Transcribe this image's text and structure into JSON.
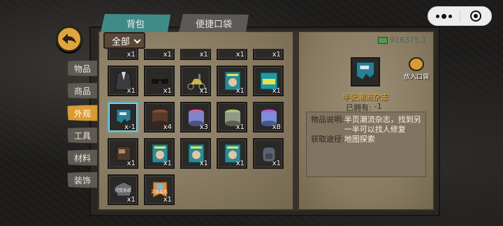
{
  "tabs": [
    {
      "label": "背包",
      "active": true
    },
    {
      "label": "便捷口袋",
      "active": false
    }
  ],
  "filter": {
    "selected": "全部"
  },
  "categories": [
    {
      "label": "物品",
      "active": false
    },
    {
      "label": "商品",
      "active": false
    },
    {
      "label": "外观",
      "active": true
    },
    {
      "label": "工具",
      "active": false
    },
    {
      "label": "材料",
      "active": false
    },
    {
      "label": "装饰",
      "active": false
    }
  ],
  "partial_row": [
    {
      "qty": "x1"
    },
    {
      "qty": "x1"
    },
    {
      "qty": "x1"
    },
    {
      "qty": "x1"
    },
    {
      "qty": "x1"
    }
  ],
  "items": [
    {
      "name": "suit-jacket",
      "qty": "x1",
      "selected": false,
      "label": ""
    },
    {
      "name": "sunglasses",
      "qty": "x1",
      "selected": false,
      "label": ""
    },
    {
      "name": "scooter",
      "qty": "x1",
      "selected": false,
      "label": ""
    },
    {
      "name": "magazine",
      "qty": "x1",
      "selected": false,
      "label": ""
    },
    {
      "name": "sticker-pack",
      "qty": "x1",
      "selected": false,
      "label": ""
    },
    {
      "name": "half-trend-magazine",
      "qty": "x-1",
      "selected": true,
      "label": ""
    },
    {
      "name": "brown-paint-can",
      "qty": "x4",
      "selected": false,
      "label": ""
    },
    {
      "name": "pink-paint-can",
      "qty": "x3",
      "selected": false,
      "label": ""
    },
    {
      "name": "green-paint-can",
      "qty": "x1",
      "selected": false,
      "label": ""
    },
    {
      "name": "purple-paint-can",
      "qty": "x8",
      "selected": false,
      "label": ""
    },
    {
      "name": "leather-wallet",
      "qty": "x1",
      "selected": false,
      "label": ""
    },
    {
      "name": "magazine",
      "qty": "x1",
      "selected": false,
      "label": ""
    },
    {
      "name": "magazine",
      "qty": "x1",
      "selected": false,
      "label": ""
    },
    {
      "name": "magazine",
      "qty": "x1",
      "selected": false,
      "label": ""
    },
    {
      "name": "backpack",
      "qty": "x1",
      "selected": false,
      "label": ""
    },
    {
      "name": "badge-plate",
      "qty": "x1",
      "selected": false,
      "label": "视觉系统"
    },
    {
      "name": "banner-flag",
      "qty": "x1",
      "selected": false,
      "label": "文化杂志"
    }
  ],
  "detail": {
    "money": "916375.1",
    "put_in_pocket": "放入口袋",
    "item_name": "半张潮流杂志",
    "owned_label": "已拥有:",
    "owned_value": "-1",
    "desc_label": "物品说明:",
    "desc_text": "半页潮流杂志，找到另一半可以找人修复",
    "source_label": "获取途径:",
    "source_text": "地图探索"
  },
  "colors": {
    "accent_tab": "#3f8b8a",
    "active_category": "#d99b34",
    "selected_slot": "#5fb3c7",
    "item_name": "#e7b24a"
  }
}
